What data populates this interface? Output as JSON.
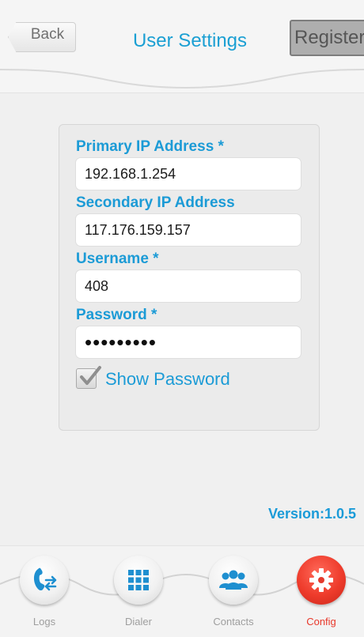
{
  "header": {
    "back_label": "Back",
    "title": "User Settings",
    "register_label": "Register"
  },
  "form": {
    "primary_ip": {
      "label": "Primary IP Address *",
      "value": "192.168.1.254"
    },
    "secondary_ip": {
      "label": "Secondary IP Address",
      "value": "117.176.159.157"
    },
    "username": {
      "label": "Username *",
      "value": "408"
    },
    "password": {
      "label": "Password *",
      "value": "•••••••••"
    },
    "show_password": {
      "label": "Show Password",
      "checked": true
    }
  },
  "version": "Version:1.0.5",
  "tabs": [
    {
      "label": "Logs",
      "icon": "phone-swap-icon",
      "active": false
    },
    {
      "label": "Dialer",
      "icon": "keypad-grid-icon",
      "active": false
    },
    {
      "label": "Contacts",
      "icon": "contacts-group-icon",
      "active": false
    },
    {
      "label": "Config",
      "icon": "gear-icon",
      "active": true
    }
  ],
  "colors": {
    "accent": "#1a9bd8",
    "active_tab": "#e8372a"
  }
}
